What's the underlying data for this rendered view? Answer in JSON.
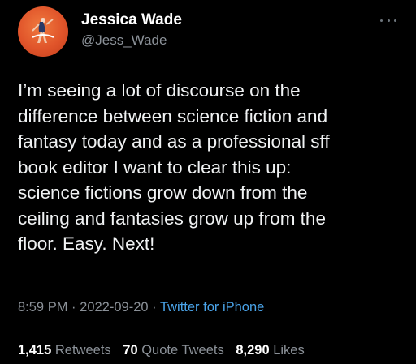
{
  "author": {
    "display_name": "Jessica Wade",
    "handle": "@Jess_Wade",
    "avatar_color": "#e0542a"
  },
  "tweet": {
    "lines": [
      "I’m seeing a lot of discourse on the",
      "difference between science fiction and",
      "fantasy today and as a professional sff",
      "book editor I want to clear this up:",
      "science fictions grow down from the",
      "ceiling and fantasies grow up from the",
      "floor. Easy. Next!"
    ]
  },
  "meta": {
    "time": "8:59 PM",
    "separator": "·",
    "date": "2022-09-20",
    "source": "Twitter for iPhone"
  },
  "stats": {
    "retweets_count": "1,415",
    "retweets_label": "Retweets",
    "quotes_count": "70",
    "quotes_label": "Quote Tweets",
    "likes_count": "8,290",
    "likes_label": "Likes"
  },
  "icons": {
    "more": "more-options-icon"
  },
  "colors": {
    "background": "#000000",
    "text": "#e7e9ea",
    "secondary": "#8b9198",
    "link": "#4aa3e8"
  }
}
